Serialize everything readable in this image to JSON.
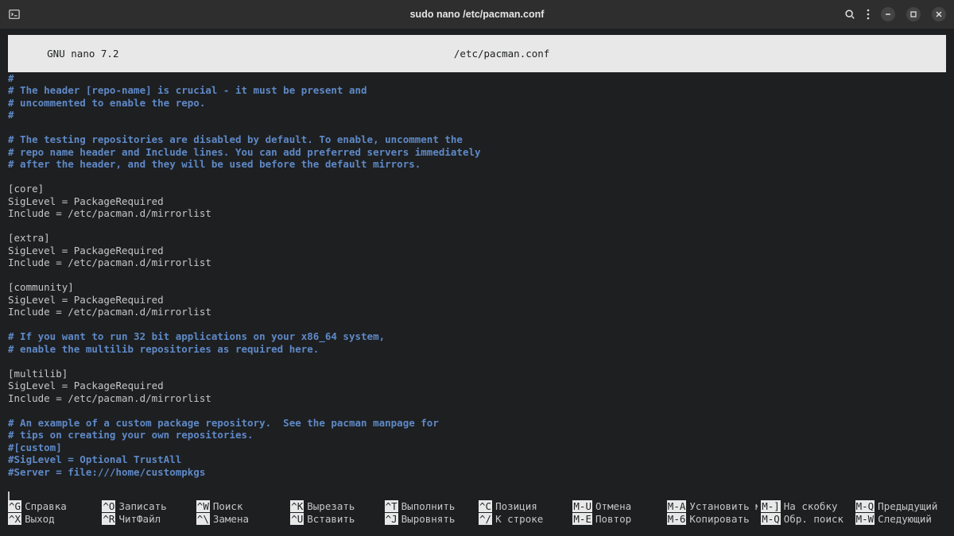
{
  "window": {
    "title": "sudo nano /etc/pacman.conf"
  },
  "nano": {
    "version_left": "  GNU nano 7.2",
    "filename": "/etc/pacman.conf"
  },
  "content": [
    {
      "t": "comment",
      "s": "#"
    },
    {
      "t": "comment",
      "s": "# The header [repo-name] is crucial - it must be present and"
    },
    {
      "t": "comment",
      "s": "# uncommented to enable the repo."
    },
    {
      "t": "comment",
      "s": "#"
    },
    {
      "t": "blank",
      "s": ""
    },
    {
      "t": "comment",
      "s": "# The testing repositories are disabled by default. To enable, uncomment the"
    },
    {
      "t": "comment",
      "s": "# repo name header and Include lines. You can add preferred servers immediately"
    },
    {
      "t": "comment",
      "s": "# after the header, and they will be used before the default mirrors."
    },
    {
      "t": "blank",
      "s": ""
    },
    {
      "t": "plain",
      "s": "[core]"
    },
    {
      "t": "plain",
      "s": "SigLevel = PackageRequired"
    },
    {
      "t": "plain",
      "s": "Include = /etc/pacman.d/mirrorlist"
    },
    {
      "t": "blank",
      "s": ""
    },
    {
      "t": "plain",
      "s": "[extra]"
    },
    {
      "t": "plain",
      "s": "SigLevel = PackageRequired"
    },
    {
      "t": "plain",
      "s": "Include = /etc/pacman.d/mirrorlist"
    },
    {
      "t": "blank",
      "s": ""
    },
    {
      "t": "plain",
      "s": "[community]"
    },
    {
      "t": "plain",
      "s": "SigLevel = PackageRequired"
    },
    {
      "t": "plain",
      "s": "Include = /etc/pacman.d/mirrorlist"
    },
    {
      "t": "blank",
      "s": ""
    },
    {
      "t": "comment",
      "s": "# If you want to run 32 bit applications on your x86_64 system,"
    },
    {
      "t": "comment",
      "s": "# enable the multilib repositories as required here."
    },
    {
      "t": "blank",
      "s": ""
    },
    {
      "t": "plain",
      "s": "[multilib]"
    },
    {
      "t": "plain",
      "s": "SigLevel = PackageRequired"
    },
    {
      "t": "plain",
      "s": "Include = /etc/pacman.d/mirrorlist"
    },
    {
      "t": "blank",
      "s": ""
    },
    {
      "t": "comment",
      "s": "# An example of a custom package repository.  See the pacman manpage for"
    },
    {
      "t": "comment",
      "s": "# tips on creating your own repositories."
    },
    {
      "t": "comment",
      "s": "#[custom]"
    },
    {
      "t": "comment",
      "s": "#SigLevel = Optional TrustAll"
    },
    {
      "t": "comment",
      "s": "#Server = file:///home/custompkgs"
    }
  ],
  "shortcuts_row1": [
    {
      "key": "^G",
      "label": "Справка"
    },
    {
      "key": "^O",
      "label": "Записать"
    },
    {
      "key": "^W",
      "label": "Поиск"
    },
    {
      "key": "^K",
      "label": "Вырезать"
    },
    {
      "key": "^T",
      "label": "Выполнить"
    },
    {
      "key": "^C",
      "label": "Позиция"
    },
    {
      "key": "M-U",
      "label": "Отмена"
    },
    {
      "key": "M-A",
      "label": "Установить ме"
    },
    {
      "key": "M-]",
      "label": "На скобку"
    },
    {
      "key": "M-Q",
      "label": "Предыдущий"
    }
  ],
  "shortcuts_row2": [
    {
      "key": "^X",
      "label": "Выход"
    },
    {
      "key": "^R",
      "label": "ЧитФайл"
    },
    {
      "key": "^\\",
      "label": "Замена"
    },
    {
      "key": "^U",
      "label": "Вставить"
    },
    {
      "key": "^J",
      "label": "Выровнять"
    },
    {
      "key": "^/",
      "label": "К строке"
    },
    {
      "key": "M-E",
      "label": "Повтор"
    },
    {
      "key": "M-6",
      "label": "Копировать"
    },
    {
      "key": "M-Q",
      "label": "Обр. поиск"
    },
    {
      "key": "M-W",
      "label": "Следующий"
    }
  ]
}
